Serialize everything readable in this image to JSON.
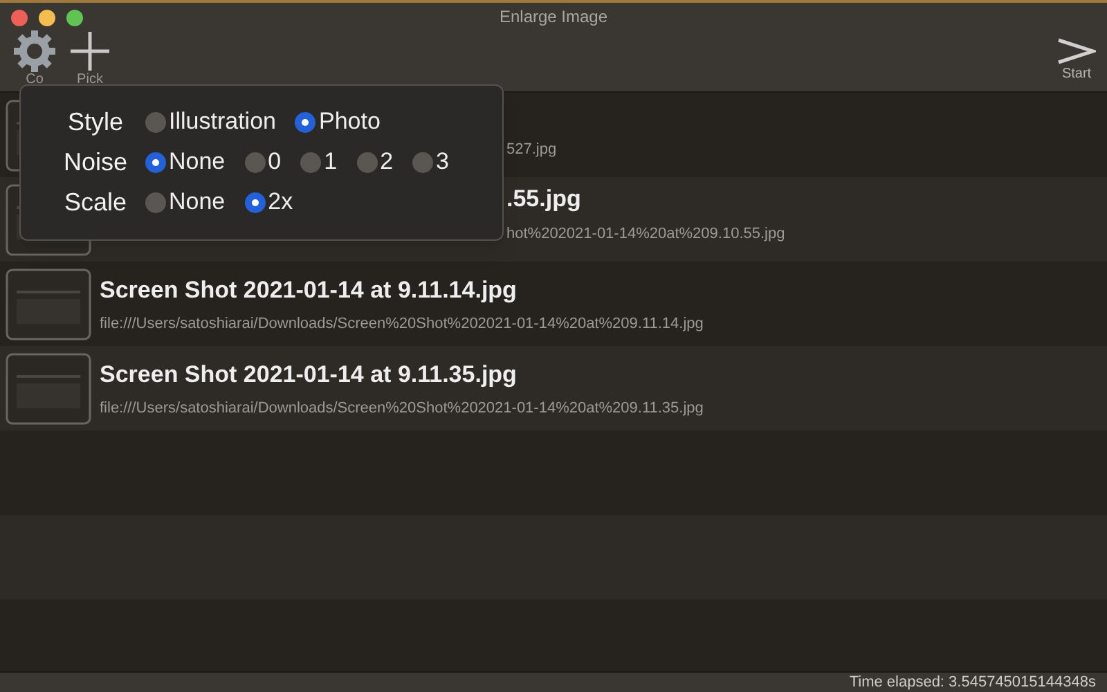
{
  "window": {
    "title": "Enlarge Image"
  },
  "toolbar": {
    "left": [
      {
        "kind": "gear",
        "label": "Co"
      },
      {
        "kind": "plus",
        "label": "Pick"
      }
    ],
    "right": {
      "kind": "chevron",
      "label": "Start"
    }
  },
  "files": [
    {
      "kind": "covered",
      "path": "527.jpg"
    },
    {
      "kind": "covered",
      "title": ".55.jpg",
      "path": "hot%202021-01-14%20at%209.10.55.jpg"
    },
    {
      "kind": "full",
      "title": "Screen Shot 2021-01-14 at 9.11.14.jpg",
      "path": "file:///Users/satoshiarai/Downloads/Screen%20Shot%202021-01-14%20at%209.11.14.jpg"
    },
    {
      "kind": "full",
      "title": "Screen Shot 2021-01-14 at 9.11.35.jpg",
      "path": "file:///Users/satoshiarai/Downloads/Screen%20Shot%202021-01-14%20at%209.11.35.jpg"
    }
  ],
  "settings": [
    {
      "label": "Style",
      "options": [
        {
          "label": "Illustration",
          "selected": false
        },
        {
          "label": "Photo",
          "selected": true
        }
      ]
    },
    {
      "label": "Noise",
      "options": [
        {
          "label": "None",
          "selected": true
        },
        {
          "label": "0",
          "selected": false
        },
        {
          "label": "1",
          "selected": false
        },
        {
          "label": "2",
          "selected": false
        },
        {
          "label": "3",
          "selected": false
        }
      ]
    },
    {
      "label": "Scale",
      "options": [
        {
          "label": "None",
          "selected": false
        },
        {
          "label": "2x",
          "selected": true
        }
      ]
    }
  ],
  "status_bar": {
    "text": "Time elapsed: 3.545745015144348s"
  }
}
